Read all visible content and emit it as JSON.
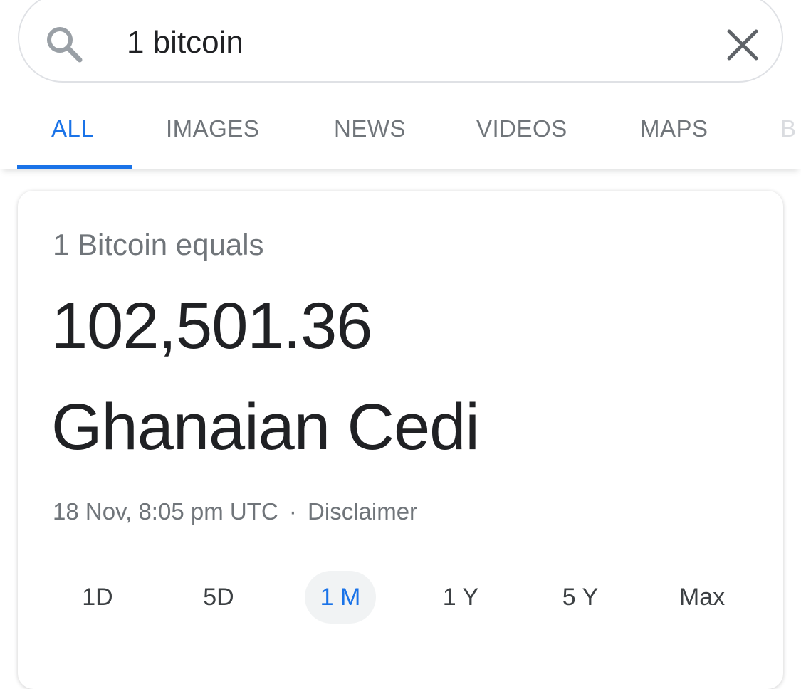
{
  "search": {
    "query": "1 bitcoin",
    "search_icon": "search-icon",
    "clear_icon": "close-icon"
  },
  "tabs": [
    {
      "label": "ALL",
      "active": true
    },
    {
      "label": "IMAGES",
      "active": false
    },
    {
      "label": "NEWS",
      "active": false
    },
    {
      "label": "VIDEOS",
      "active": false
    },
    {
      "label": "MAPS",
      "active": false
    },
    {
      "label": "B",
      "active": false
    }
  ],
  "converter": {
    "equals_label": "1 Bitcoin equals",
    "value": "102,501.36",
    "currency": "Ghanaian Cedi",
    "timestamp": "18 Nov, 8:05 pm UTC",
    "separator": "·",
    "disclaimer": "Disclaimer",
    "ranges": [
      {
        "label": "1D",
        "active": false
      },
      {
        "label": "5D",
        "active": false
      },
      {
        "label": "1 M",
        "active": true
      },
      {
        "label": "1 Y",
        "active": false
      },
      {
        "label": "5 Y",
        "active": false
      },
      {
        "label": "Max",
        "active": false
      }
    ]
  },
  "colors": {
    "accent": "#1a73e8",
    "text_primary": "#202124",
    "text_secondary": "#70757a"
  }
}
